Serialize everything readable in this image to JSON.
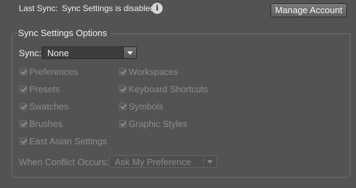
{
  "status": {
    "last_sync_label": "Last Sync:",
    "last_sync_value": "Sync Settings is disabled",
    "info_icon": "info-icon",
    "info_glyph": "i"
  },
  "manage_account_button": "Manage Account",
  "options": {
    "group_title": "Sync Settings Options",
    "sync_label": "Sync:",
    "sync_value": "None",
    "checkboxes": [
      {
        "label": "Preferences",
        "checked": true,
        "enabled": false
      },
      {
        "label": "Workspaces",
        "checked": true,
        "enabled": false
      },
      {
        "label": "Presets",
        "checked": true,
        "enabled": false
      },
      {
        "label": "Keyboard Shortcuts",
        "checked": true,
        "enabled": false
      },
      {
        "label": "Swatches",
        "checked": true,
        "enabled": false
      },
      {
        "label": "Symbols",
        "checked": true,
        "enabled": false
      },
      {
        "label": "Brushes",
        "checked": true,
        "enabled": false
      },
      {
        "label": "Graphic Styles",
        "checked": true,
        "enabled": false
      },
      {
        "label": "East Asian Settings",
        "checked": true,
        "enabled": false
      }
    ],
    "conflict_label": "When Conflict Occurs:",
    "conflict_value": "Ask My Preference"
  },
  "colors": {
    "panel_bg": "#535353",
    "text": "#f2f2f2",
    "disabled_text": "#8c8c8c"
  }
}
